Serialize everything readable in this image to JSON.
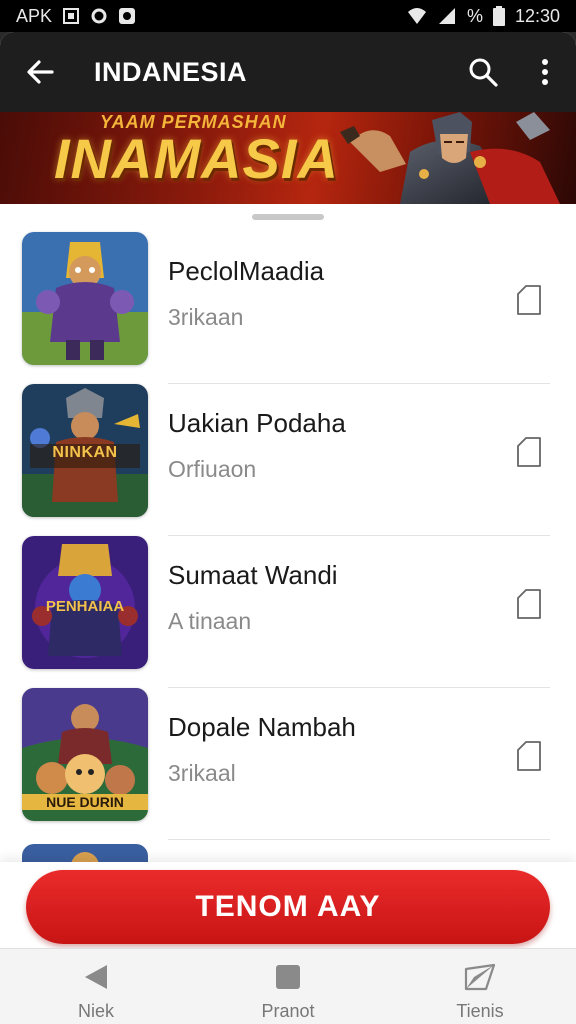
{
  "status_bar": {
    "carrier": "APK",
    "battery": "%",
    "time": "12:30",
    "icons": [
      "notification-icon",
      "sync-icon",
      "record-icon",
      "wifi-icon",
      "signal-icon",
      "battery-icon"
    ]
  },
  "toolbar": {
    "title": "INDANESIA",
    "back_icon": "arrow-left-icon",
    "search_icon": "search-icon",
    "more_icon": "more-vertical-icon"
  },
  "banner": {
    "subtitle": "YAAM PERMASHAN",
    "title": "INAMASIA"
  },
  "list": {
    "items": [
      {
        "name": "PeclolMaadia",
        "sub": "3rikaan",
        "thumb_color": "#3a6fb0",
        "thumb_label": ""
      },
      {
        "name": "Uakian Podaha",
        "sub": "Orfiuaon",
        "thumb_color": "#2b5d34",
        "thumb_label": "NINKAN"
      },
      {
        "name": "Sumaat Wandi",
        "sub": "A tinaan",
        "thumb_color": "#3a1f7a",
        "thumb_label": "PENHAIAA"
      },
      {
        "name": "Dopale Nambah",
        "sub": "3rikaal",
        "thumb_color": "#2d6a3a",
        "thumb_label": "NUE DURIN"
      }
    ]
  },
  "cta": {
    "label": "TENOM AAY"
  },
  "nav": {
    "items": [
      {
        "label": "Niek",
        "icon": "back-triangle-icon"
      },
      {
        "label": "Pranot",
        "icon": "square-icon"
      },
      {
        "label": "Tienis",
        "icon": "paper-plane-icon"
      }
    ]
  },
  "colors": {
    "accent_red": "#d81e1e",
    "toolbar_bg": "#1e1e1e",
    "banner_gold": "#f7c948"
  }
}
